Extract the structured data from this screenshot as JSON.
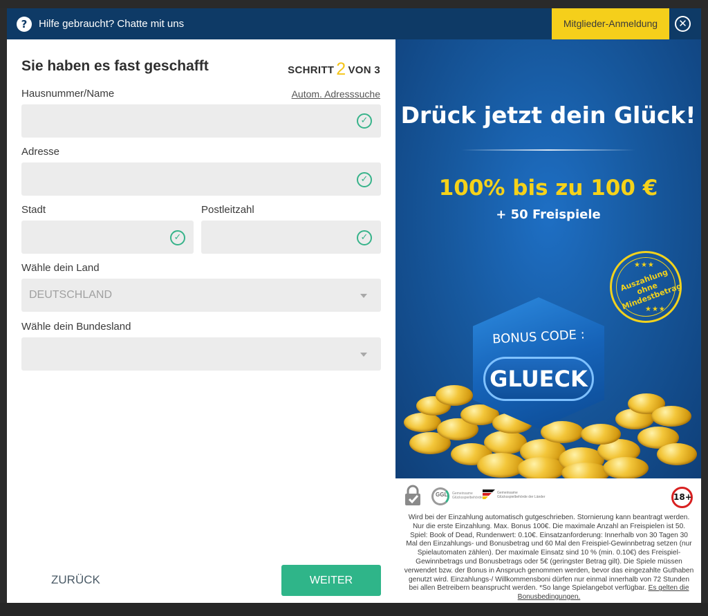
{
  "topbar": {
    "help_text": "Hilfe gebraucht? Chatte mit uns",
    "login_label": "Mitglieder-Anmeldung"
  },
  "form": {
    "title": "Sie haben es fast geschafft",
    "step_prefix": "SCHRITT",
    "step_current": "2",
    "step_suffix": "VON 3",
    "house_label": "Hausnummer/Name",
    "address_search_link": "Autom. Adresssuche",
    "house_value": "",
    "address_label": "Adresse",
    "address_value": "",
    "city_label": "Stadt",
    "city_value": "",
    "postcode_label": "Postleitzahl",
    "postcode_value": "",
    "country_label": "Wähle dein Land",
    "country_value": "DEUTSCHLAND",
    "state_label": "Wähle dein Bundesland",
    "state_value": "",
    "back_label": "ZURÜCK",
    "next_label": "WEITER"
  },
  "promo": {
    "headline": "Drück jetzt dein Glück!",
    "offer": "100% bis zu 100 €",
    "spins": "+ 50 Freispiele",
    "seal_line1": "Auszahlung ohne",
    "seal_line2": "Mindestbetrag",
    "bonus_label": "BONUS CODE :",
    "bonus_code": "GLUECK",
    "ggl_text": "GGL",
    "ggl_sub": "Gemeinsame Glücksspielbehörde",
    "flag_text": "Gemeinsame Glücksspielbehörde der Länder",
    "age_badge": "18+",
    "terms": "Wird bei der Einzahlung automatisch gutgeschrieben. Stornierung kann beantragt werden. Nur die erste Einzahlung. Max. Bonus 100€. Die maximale Anzahl an Freispielen ist 50. Spiel: Book of Dead, Rundenwert: 0.10€. Einsatzanforderung: Innerhalb von 30 Tagen 30 Mal den Einzahlungs- und Bonusbetrag und 60 Mal den Freispiel-Gewinnbetrag setzen (nur Spielautomaten zählen). Der maximale Einsatz sind 10 % (min. 0.10€) des Freispiel-Gewinnbetrags und Bonusbetrags oder 5€ (geringster Betrag gilt). Die Spiele müssen verwendet bzw. der Bonus in Anspruch genommen werden, bevor das eingezahlte Guthaben genutzt wird. Einzahlungs-/ Willkommensboni dürfen nur einmal innerhalb von 72 Stunden bei allen Betreibern beansprucht werden. *So lange Spielangebot verfügbar.",
    "terms_link": "Es gelten die Bonusbedingungen."
  },
  "colors": {
    "topbar_bg": "#0e3a66",
    "login_button_bg": "#f5cf1b",
    "next_button_bg": "#2fb589",
    "check_color": "#37b38a",
    "step_number_color": "#f5c518",
    "offer_color": "#f5d21a"
  },
  "icons": {
    "help": "question-circle-icon",
    "close": "close-circle-icon",
    "check": "check-circle-icon",
    "dropdown": "caret-down-icon",
    "lock": "lock-check-icon"
  }
}
